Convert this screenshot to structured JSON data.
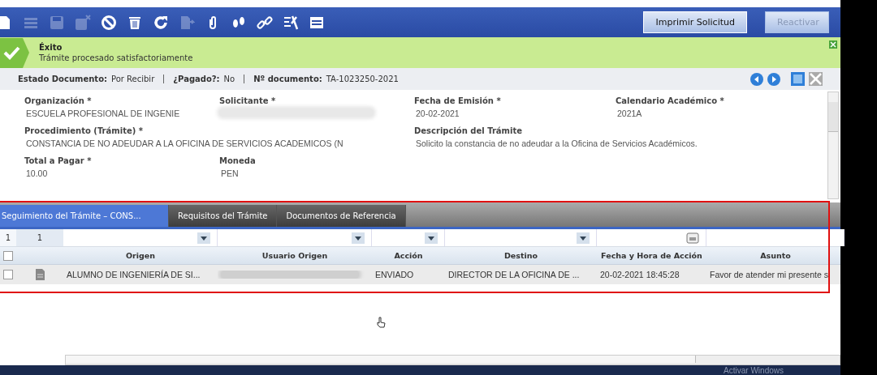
{
  "toolbar": {
    "tools": [
      {
        "kind": "new",
        "disabled": false
      },
      {
        "kind": "list",
        "disabled": true
      },
      {
        "kind": "save",
        "disabled": true
      },
      {
        "kind": "save-close",
        "disabled": true
      },
      {
        "kind": "cancel",
        "disabled": false
      },
      {
        "kind": "delete",
        "disabled": false
      },
      {
        "kind": "refresh",
        "disabled": false
      },
      {
        "kind": "export",
        "disabled": true
      },
      {
        "kind": "attach",
        "disabled": false
      },
      {
        "kind": "steps",
        "disabled": false
      },
      {
        "kind": "link",
        "disabled": false
      },
      {
        "kind": "tools",
        "disabled": false
      },
      {
        "kind": "form",
        "disabled": false
      }
    ],
    "buttons": [
      {
        "label": "Imprimir Solicitud",
        "disabled": false
      },
      {
        "label": "Reactivar",
        "disabled": true
      }
    ]
  },
  "message": {
    "title": "Éxito",
    "text": "Trámite procesado satisfactoriamente"
  },
  "status": [
    {
      "label": "Estado Documento:",
      "value": "Por Recibir"
    },
    {
      "label": "¿Pagado?:",
      "value": "No"
    },
    {
      "label": "Nº documento:",
      "value": "TA-1023250-2021"
    }
  ],
  "form": {
    "fields": [
      {
        "label": "Organización *",
        "value": "ESCUELA PROFESIONAL DE INGENIE",
        "kind": "text",
        "wide": false
      },
      {
        "label": "Solicitante *",
        "kind": "redacted",
        "wide": false
      },
      {
        "label": "Fecha de Emisión *",
        "value": "20-02-2021",
        "kind": "text",
        "wide": false
      },
      {
        "label": "Calendario Académico *",
        "value": "2021A",
        "kind": "text",
        "wide": false
      },
      {
        "label": "Procedimiento (Trámite) *",
        "value": "CONSTANCIA DE NO ADEUDAR A LA OFICINA DE SERVICIOS ACADEMICOS (N",
        "kind": "text",
        "wide": true
      },
      {
        "label": "Descripción del Trámite",
        "value": "Solicito la constancia de no adeudar a la Oficina de Servicios Académicos.",
        "kind": "text",
        "wide": true
      },
      {
        "label": "Total a Pagar *",
        "value": "10.00",
        "kind": "text",
        "wide": false
      },
      {
        "label": "Moneda",
        "value": "PEN",
        "kind": "text",
        "wide": false
      }
    ]
  },
  "tabs": [
    {
      "label": "Seguimiento del Trámite – CONS...",
      "selected": true
    },
    {
      "label": "Requisitos del Trámite",
      "selected": false
    },
    {
      "label": "Documentos de Referencia",
      "selected": false
    }
  ],
  "grid": {
    "counters": [
      "1",
      "1"
    ],
    "all_checked": false,
    "columns": [
      {
        "name": "Origen",
        "kind": "dropdown"
      },
      {
        "name": "Usuario Origen",
        "kind": "dropdown"
      },
      {
        "name": "Acción",
        "kind": "dropdown"
      },
      {
        "name": "Destino",
        "kind": "dropdown"
      },
      {
        "name": "Fecha y Hora de Acción",
        "kind": "calendar"
      },
      {
        "name": "Asunto",
        "kind": "plain"
      }
    ],
    "rows": [
      {
        "checked": false,
        "cells": [
          {
            "text": "ALUMNO DE INGENIERÍA DE SI...",
            "kind": "text"
          },
          {
            "kind": "redacted"
          },
          {
            "text": "ENVIADO",
            "kind": "text"
          },
          {
            "text": "DIRECTOR DE LA OFICINA DE ...",
            "kind": "text"
          },
          {
            "text": "20-02-2021 18:45:28",
            "kind": "text"
          },
          {
            "text": "Favor de atender mi presente s",
            "kind": "text"
          }
        ]
      }
    ]
  },
  "os_notice": "Activar Windows"
}
